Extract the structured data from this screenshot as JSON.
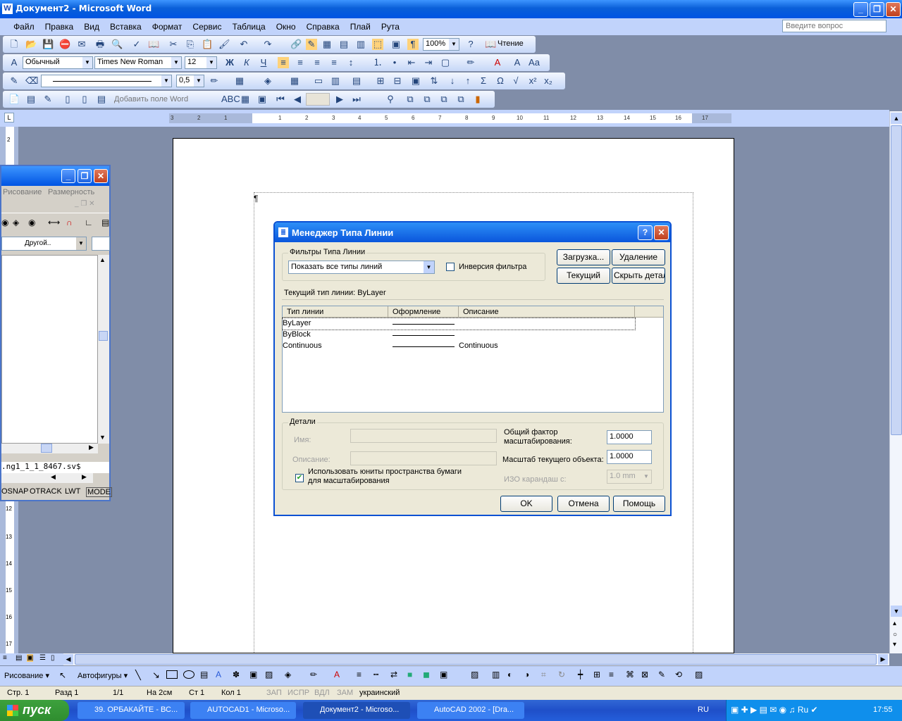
{
  "window": {
    "title": "Документ2 - Microsoft Word"
  },
  "menu": [
    "Файл",
    "Правка",
    "Вид",
    "Вставка",
    "Формат",
    "Сервис",
    "Таблица",
    "Окно",
    "Справка",
    "Плай",
    "Рута"
  ],
  "ask_placeholder": "Введите вопрос",
  "toolbar1": {
    "zoom": "100%",
    "reading": "Чтение"
  },
  "toolbar2": {
    "style": "Обычный",
    "font": "Times New Roman",
    "size": "12"
  },
  "toolbar3": {
    "line_weight": "0,5"
  },
  "toolbar4": {
    "add_field": "Добавить поле Word"
  },
  "ruler_labels": [
    "3",
    "2",
    "1",
    "1",
    "2",
    "3",
    "4",
    "5",
    "6",
    "7",
    "8",
    "9",
    "10",
    "11",
    "12",
    "13",
    "14",
    "15",
    "16",
    "17"
  ],
  "vruler_labels": [
    "2",
    "12",
    "13",
    "14",
    "15",
    "16",
    "17"
  ],
  "acad_panel": {
    "menu1": "Рисование",
    "menu2": "Размерность",
    "combo": "Другой..",
    "cmd": ".ng1_1_1_8467.sv$",
    "status": [
      "OSNAP",
      "OTRACK",
      "LWT",
      "MODE"
    ]
  },
  "dialog": {
    "title": "Менеджер Типа Линии",
    "filters_label": "Фильтры Типа Линии",
    "filter_combo": "Показать все типы линий",
    "invert_label": "Инверсия фильтра",
    "buttons": {
      "load": "Загрузка...",
      "delete": "Удаление",
      "current": "Текущий",
      "hide_details": "Скрыть детал",
      "ok": "OK",
      "cancel": "Отмена",
      "help": "Помощь"
    },
    "current_linetype": "Текущий тип линии:  ByLayer",
    "columns": [
      "Тип линии",
      "Оформление",
      "Описание"
    ],
    "rows": [
      {
        "name": "ByLayer",
        "desc": ""
      },
      {
        "name": "ByBlock",
        "desc": ""
      },
      {
        "name": "Continuous",
        "desc": "Continuous"
      }
    ],
    "details": {
      "label": "Детали",
      "name_label": "Имя:",
      "desc_label": "Описание:",
      "global_scale_label": "Общий фактор масштабирования:",
      "global_scale": "1.0000",
      "current_scale_label": "Масштаб текущего объекта:",
      "current_scale": "1.0000",
      "paper_space": "Использовать юниты пространства бумаги для масштабирования",
      "iso_label": "ИЗО карандаш с:",
      "iso_value": "1.0 mm"
    }
  },
  "drawbar": {
    "draw": "Рисование",
    "autoshapes": "Автофигуры"
  },
  "status": {
    "page": "Стр. 1",
    "section": "Разд 1",
    "pages": "1/1",
    "at": "На 2см",
    "line": "Ст 1",
    "col": "Кол 1",
    "rec": "ЗАП",
    "trk": "ИСПР",
    "ext": "ВДЛ",
    "ovr": "ЗАМ",
    "lang": "украинский"
  },
  "taskbar": {
    "start": "пуск",
    "tasks": [
      "39. ОРБАКАЙТЕ - ВС...",
      "AUTOCAD1 - Microso...",
      "Документ2 - Microso...",
      "AutoCAD 2002 - [Dra..."
    ],
    "lang": "RU",
    "time": "17:55"
  }
}
